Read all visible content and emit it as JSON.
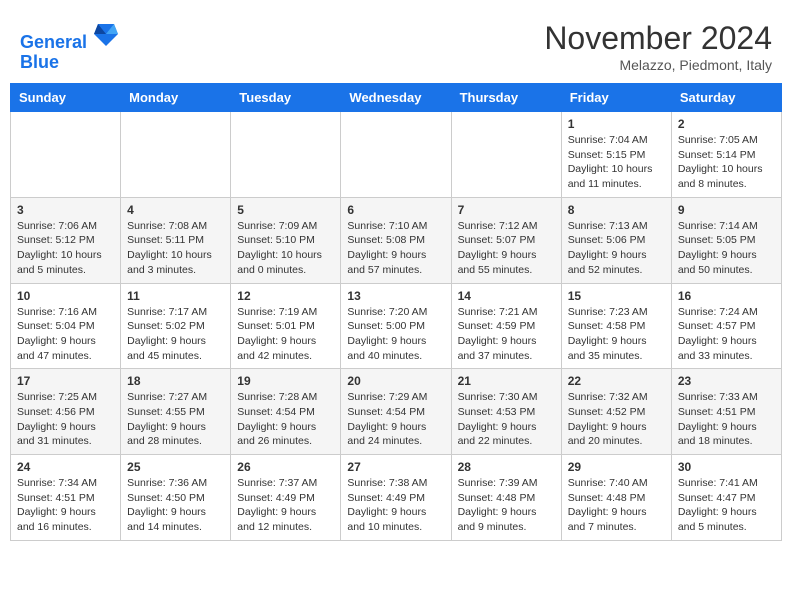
{
  "header": {
    "logo_line1": "General",
    "logo_line2": "Blue",
    "month": "November 2024",
    "location": "Melazzo, Piedmont, Italy"
  },
  "weekdays": [
    "Sunday",
    "Monday",
    "Tuesday",
    "Wednesday",
    "Thursday",
    "Friday",
    "Saturday"
  ],
  "weeks": [
    [
      {
        "day": "",
        "info": ""
      },
      {
        "day": "",
        "info": ""
      },
      {
        "day": "",
        "info": ""
      },
      {
        "day": "",
        "info": ""
      },
      {
        "day": "",
        "info": ""
      },
      {
        "day": "1",
        "info": "Sunrise: 7:04 AM\nSunset: 5:15 PM\nDaylight: 10 hours and 11 minutes."
      },
      {
        "day": "2",
        "info": "Sunrise: 7:05 AM\nSunset: 5:14 PM\nDaylight: 10 hours and 8 minutes."
      }
    ],
    [
      {
        "day": "3",
        "info": "Sunrise: 7:06 AM\nSunset: 5:12 PM\nDaylight: 10 hours and 5 minutes."
      },
      {
        "day": "4",
        "info": "Sunrise: 7:08 AM\nSunset: 5:11 PM\nDaylight: 10 hours and 3 minutes."
      },
      {
        "day": "5",
        "info": "Sunrise: 7:09 AM\nSunset: 5:10 PM\nDaylight: 10 hours and 0 minutes."
      },
      {
        "day": "6",
        "info": "Sunrise: 7:10 AM\nSunset: 5:08 PM\nDaylight: 9 hours and 57 minutes."
      },
      {
        "day": "7",
        "info": "Sunrise: 7:12 AM\nSunset: 5:07 PM\nDaylight: 9 hours and 55 minutes."
      },
      {
        "day": "8",
        "info": "Sunrise: 7:13 AM\nSunset: 5:06 PM\nDaylight: 9 hours and 52 minutes."
      },
      {
        "day": "9",
        "info": "Sunrise: 7:14 AM\nSunset: 5:05 PM\nDaylight: 9 hours and 50 minutes."
      }
    ],
    [
      {
        "day": "10",
        "info": "Sunrise: 7:16 AM\nSunset: 5:04 PM\nDaylight: 9 hours and 47 minutes."
      },
      {
        "day": "11",
        "info": "Sunrise: 7:17 AM\nSunset: 5:02 PM\nDaylight: 9 hours and 45 minutes."
      },
      {
        "day": "12",
        "info": "Sunrise: 7:19 AM\nSunset: 5:01 PM\nDaylight: 9 hours and 42 minutes."
      },
      {
        "day": "13",
        "info": "Sunrise: 7:20 AM\nSunset: 5:00 PM\nDaylight: 9 hours and 40 minutes."
      },
      {
        "day": "14",
        "info": "Sunrise: 7:21 AM\nSunset: 4:59 PM\nDaylight: 9 hours and 37 minutes."
      },
      {
        "day": "15",
        "info": "Sunrise: 7:23 AM\nSunset: 4:58 PM\nDaylight: 9 hours and 35 minutes."
      },
      {
        "day": "16",
        "info": "Sunrise: 7:24 AM\nSunset: 4:57 PM\nDaylight: 9 hours and 33 minutes."
      }
    ],
    [
      {
        "day": "17",
        "info": "Sunrise: 7:25 AM\nSunset: 4:56 PM\nDaylight: 9 hours and 31 minutes."
      },
      {
        "day": "18",
        "info": "Sunrise: 7:27 AM\nSunset: 4:55 PM\nDaylight: 9 hours and 28 minutes."
      },
      {
        "day": "19",
        "info": "Sunrise: 7:28 AM\nSunset: 4:54 PM\nDaylight: 9 hours and 26 minutes."
      },
      {
        "day": "20",
        "info": "Sunrise: 7:29 AM\nSunset: 4:54 PM\nDaylight: 9 hours and 24 minutes."
      },
      {
        "day": "21",
        "info": "Sunrise: 7:30 AM\nSunset: 4:53 PM\nDaylight: 9 hours and 22 minutes."
      },
      {
        "day": "22",
        "info": "Sunrise: 7:32 AM\nSunset: 4:52 PM\nDaylight: 9 hours and 20 minutes."
      },
      {
        "day": "23",
        "info": "Sunrise: 7:33 AM\nSunset: 4:51 PM\nDaylight: 9 hours and 18 minutes."
      }
    ],
    [
      {
        "day": "24",
        "info": "Sunrise: 7:34 AM\nSunset: 4:51 PM\nDaylight: 9 hours and 16 minutes."
      },
      {
        "day": "25",
        "info": "Sunrise: 7:36 AM\nSunset: 4:50 PM\nDaylight: 9 hours and 14 minutes."
      },
      {
        "day": "26",
        "info": "Sunrise: 7:37 AM\nSunset: 4:49 PM\nDaylight: 9 hours and 12 minutes."
      },
      {
        "day": "27",
        "info": "Sunrise: 7:38 AM\nSunset: 4:49 PM\nDaylight: 9 hours and 10 minutes."
      },
      {
        "day": "28",
        "info": "Sunrise: 7:39 AM\nSunset: 4:48 PM\nDaylight: 9 hours and 9 minutes."
      },
      {
        "day": "29",
        "info": "Sunrise: 7:40 AM\nSunset: 4:48 PM\nDaylight: 9 hours and 7 minutes."
      },
      {
        "day": "30",
        "info": "Sunrise: 7:41 AM\nSunset: 4:47 PM\nDaylight: 9 hours and 5 minutes."
      }
    ]
  ]
}
